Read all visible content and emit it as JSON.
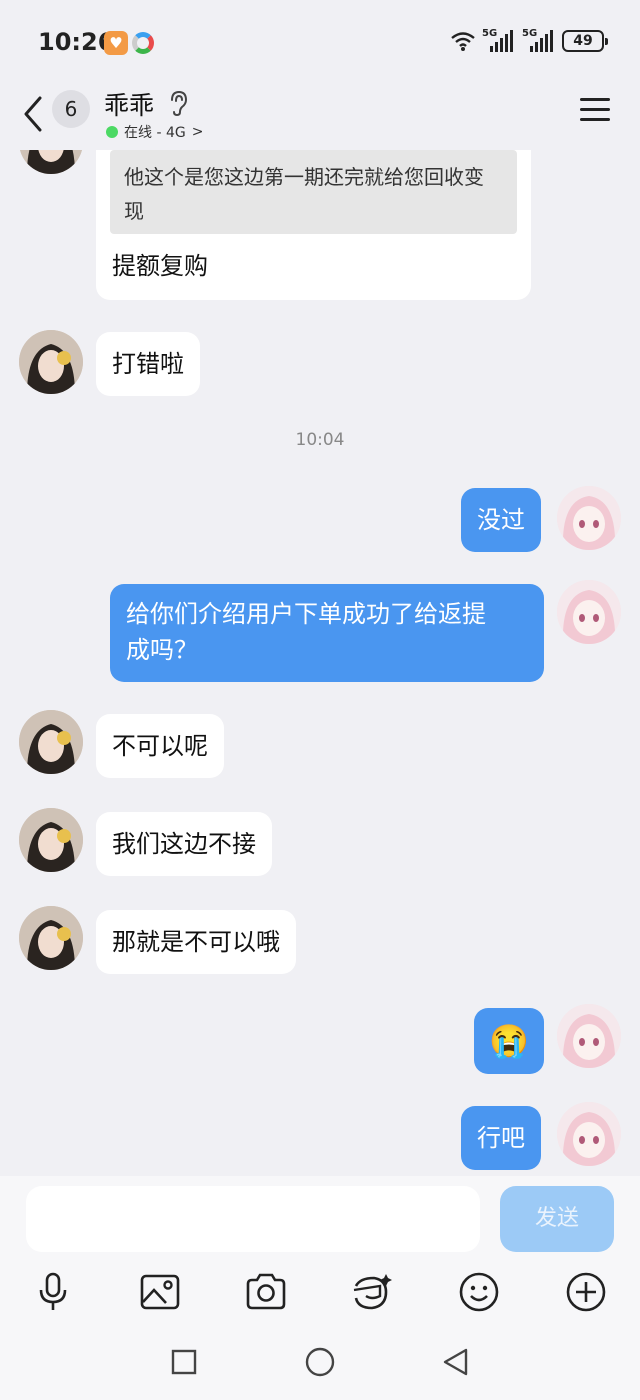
{
  "status_bar": {
    "time": "10:26",
    "network_1": "5G",
    "network_2": "5G",
    "battery": "49"
  },
  "header": {
    "unread_count": "6",
    "contact_name": "乖乖",
    "presence": "在线 - 4G",
    "presence_chevron": ">"
  },
  "chat": {
    "quote": {
      "quoted_text": "他这个是您这边第一期还完就给您回收变现",
      "reply_text": "提额复购"
    },
    "msg_1": "打错啦",
    "timestamp": "10:04",
    "msg_2": "没过",
    "msg_3_line1": "给你们介绍用户下单成功了给返提",
    "msg_3_line2": "成吗？",
    "msg_4": "不可以呢",
    "msg_5": "我们这边不接",
    "msg_6": "那就是不可以哦",
    "msg_7_emoji": "😭",
    "msg_8": "行吧"
  },
  "input": {
    "send_label": "发送"
  },
  "colors": {
    "outgoing_bubble": "#4a96f0",
    "incoming_bubble": "#ffffff",
    "background": "#f0f0f4",
    "send_disabled": "#9ccaf6"
  }
}
